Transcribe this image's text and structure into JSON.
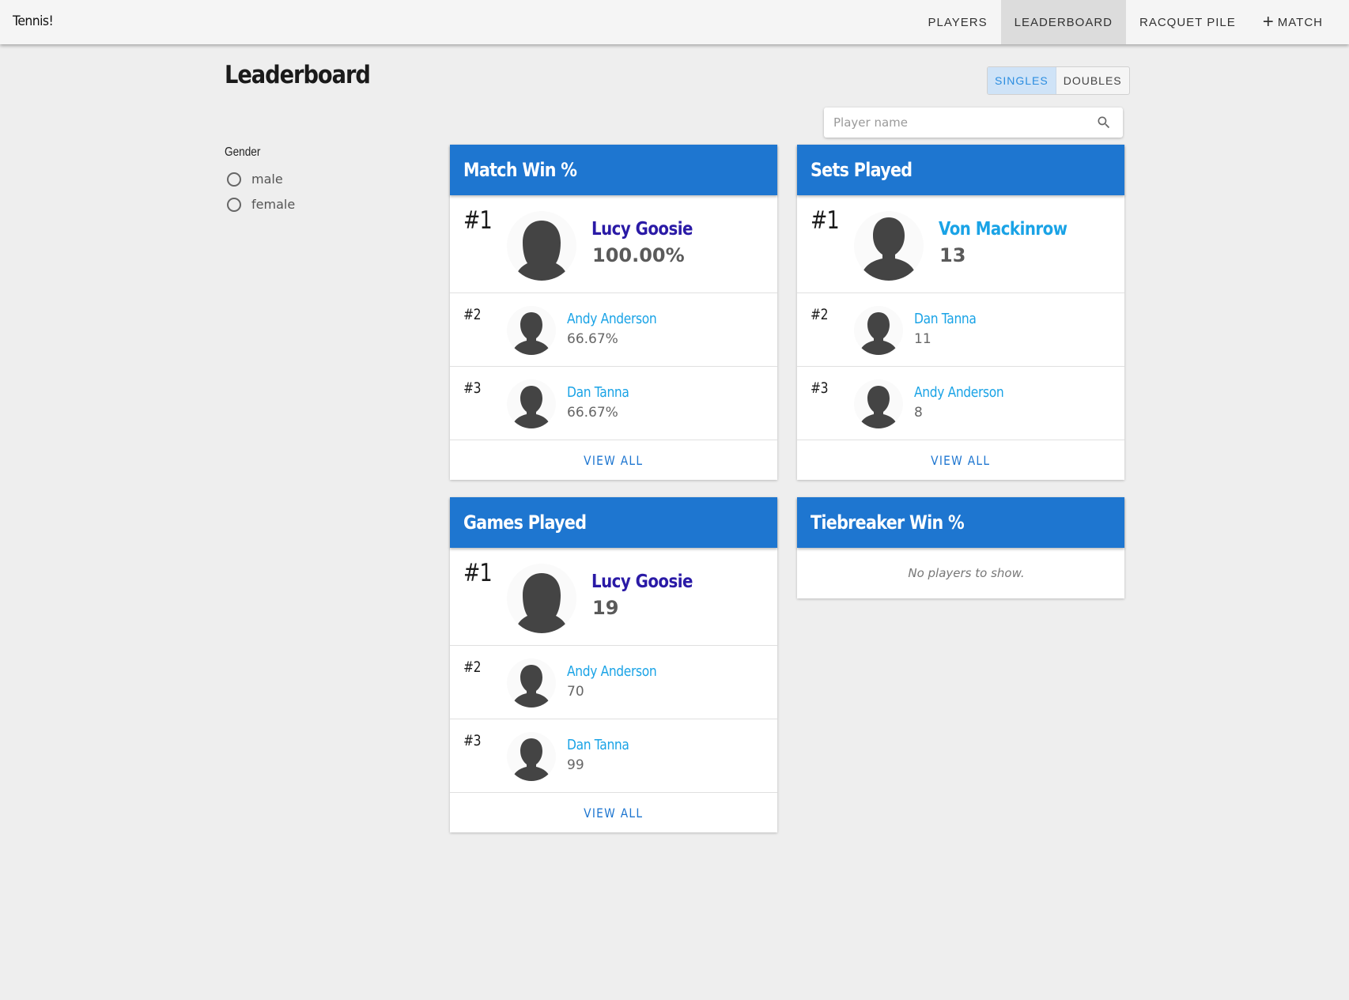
{
  "app": {
    "title": "Tennis!"
  },
  "nav": {
    "players": "PLAYERS",
    "leaderboard": "LEADERBOARD",
    "racquet_pile": "RACQUET PILE",
    "match": "MATCH"
  },
  "page": {
    "title": "Leaderboard"
  },
  "mode_toggle": {
    "singles": "SINGLES",
    "doubles": "DOUBLES",
    "selected": "SINGLES"
  },
  "search": {
    "placeholder": "Player name",
    "value": ""
  },
  "filters": {
    "gender": {
      "label": "Gender",
      "options": [
        "male",
        "female"
      ]
    }
  },
  "cards": [
    {
      "title": "Match Win %",
      "entries": [
        {
          "rank": "#1",
          "name": "Lucy Goosie",
          "value": "100.00%",
          "avatar": "female-avatar-icon"
        },
        {
          "rank": "#2",
          "name": "Andy Anderson",
          "value": "66.67%",
          "avatar": "male-avatar-icon"
        },
        {
          "rank": "#3",
          "name": "Dan Tanna",
          "value": "66.67%",
          "avatar": "male-avatar-icon"
        }
      ],
      "view_all": "VIEW ALL"
    },
    {
      "title": "Sets Played",
      "entries": [
        {
          "rank": "#1",
          "name": "Von Mackinrow",
          "value": "13",
          "avatar": "male-avatar-icon"
        },
        {
          "rank": "#2",
          "name": "Dan Tanna",
          "value": "11",
          "avatar": "male-avatar-icon"
        },
        {
          "rank": "#3",
          "name": "Andy Anderson",
          "value": "8",
          "avatar": "male-avatar-icon"
        }
      ],
      "view_all": "VIEW ALL"
    },
    {
      "title": "Games Played",
      "entries": [
        {
          "rank": "#1",
          "name": "Lucy Goosie",
          "value": "19",
          "avatar": "female-avatar-icon"
        },
        {
          "rank": "#2",
          "name": "Andy Anderson",
          "value": "70",
          "avatar": "male-avatar-icon"
        },
        {
          "rank": "#3",
          "name": "Dan Tanna",
          "value": "99",
          "avatar": "male-avatar-icon"
        }
      ],
      "view_all": "VIEW ALL"
    },
    {
      "title": "Tiebreaker Win %",
      "empty_message": "No players to show."
    }
  ],
  "colors": {
    "card_header": "#1e76d0",
    "link_blue": "#1aa3e6",
    "visited_purple": "#2a1aa6",
    "toggle_active_bg": "#cfe3f7"
  }
}
